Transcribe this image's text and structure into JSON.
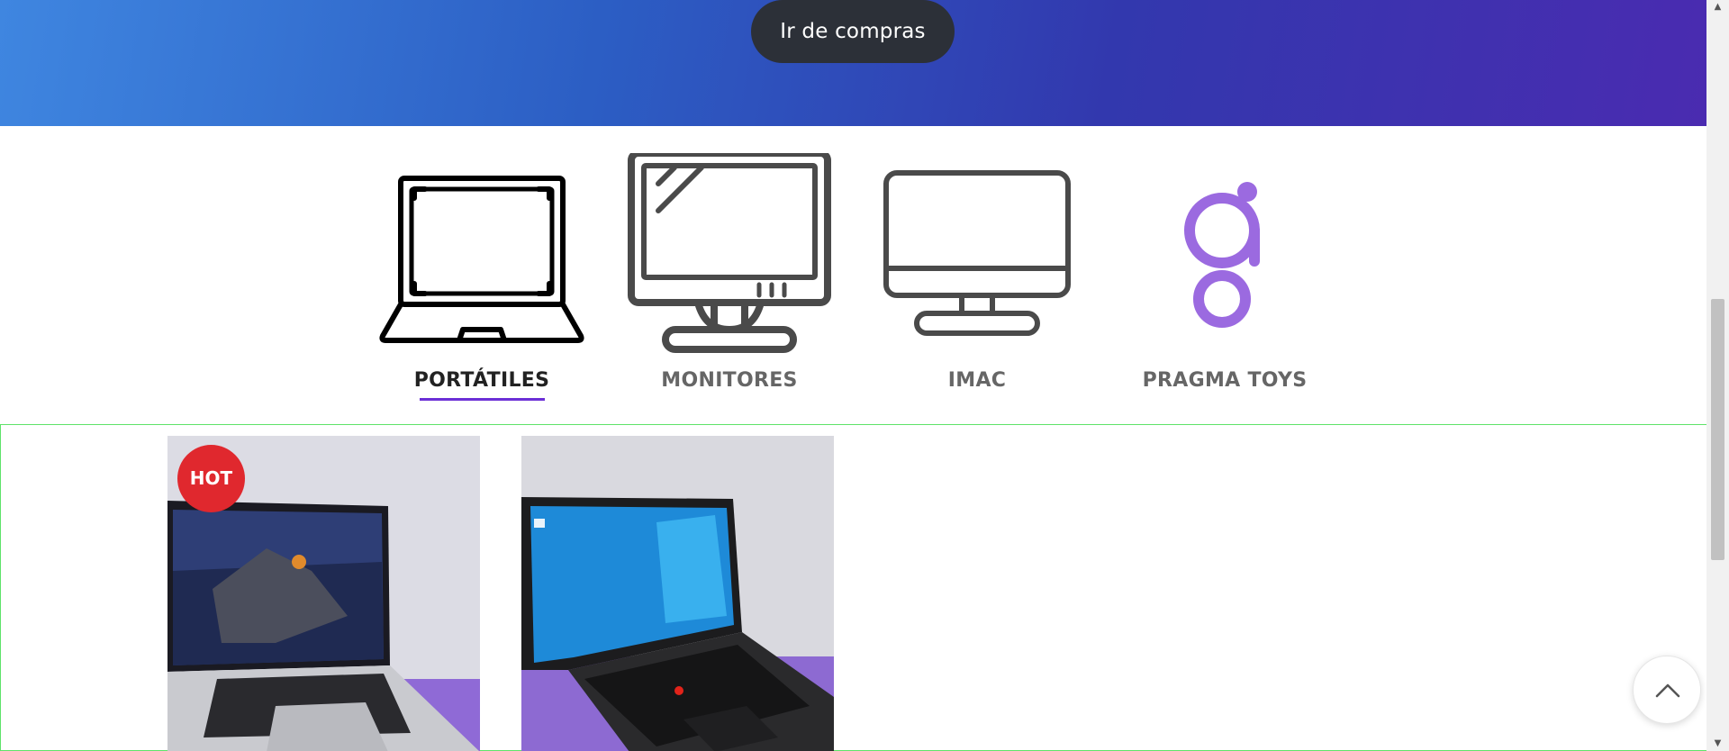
{
  "hero": {
    "button_label": "Ir de compras",
    "gradient_colors": [
      "#3f86e0",
      "#2c5ec4",
      "#3238ae",
      "#4a2bb0"
    ]
  },
  "categories": {
    "items": [
      {
        "label": "PORTÁTILES",
        "icon": "laptop-icon",
        "active": true
      },
      {
        "label": "MONITORES",
        "icon": "monitor-icon",
        "active": false
      },
      {
        "label": "IMAC",
        "icon": "imac-icon",
        "active": false
      },
      {
        "label": "PRAGMA TOYS",
        "icon": "pragma-toys-logo-icon",
        "active": false
      }
    ],
    "active_underline_color": "#6b2fd6"
  },
  "products": {
    "items": [
      {
        "badge": "HOT",
        "image": "macbook-laptop-photo"
      },
      {
        "badge": "",
        "image": "lenovo-thinkpad-laptop-photo"
      }
    ],
    "badge_color": "#e0282e"
  },
  "back_to_top": {
    "icon": "chevron-up-icon"
  }
}
